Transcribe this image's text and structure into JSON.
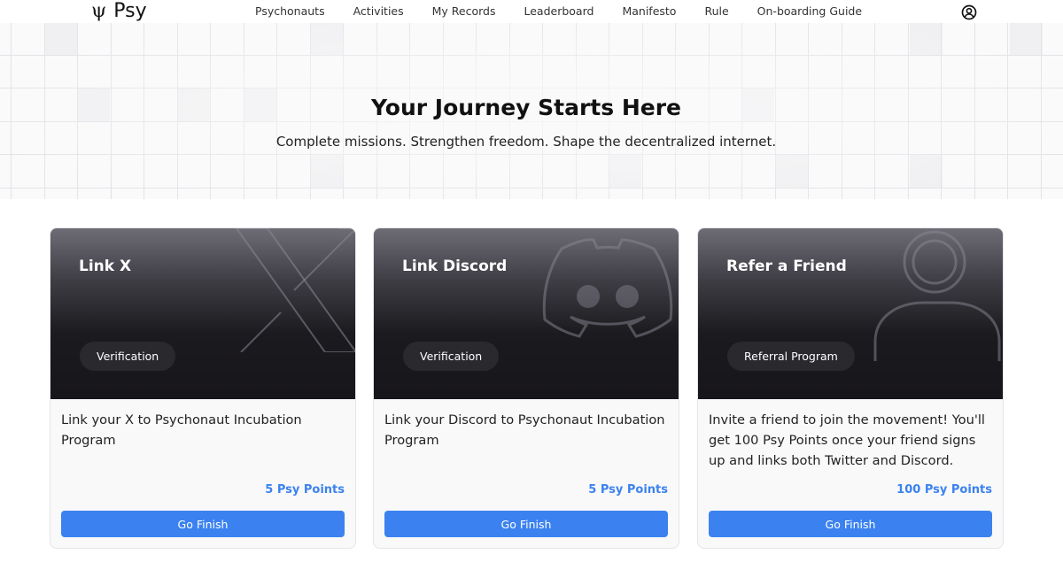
{
  "header": {
    "logo_glyph": "ψ",
    "logo_text": "Psy",
    "nav": [
      "Psychonauts",
      "Activities",
      "My Records",
      "Leaderboard",
      "Manifesto",
      "Rule",
      "On-boarding Guide"
    ],
    "profile_icon": "user-circle-icon"
  },
  "hero": {
    "title": "Your Journey Starts Here",
    "subtitle": "Complete missions. Strengthen freedom. Shape the decentralized internet."
  },
  "cards": [
    {
      "title": "Link X",
      "tag": "Verification",
      "description": "Link your X to Psychonaut Incubation Program",
      "points": "5 Psy Points",
      "button": "Go Finish",
      "icon": "x-logo-icon"
    },
    {
      "title": "Link Discord",
      "tag": "Verification",
      "description": "Link your Discord to Psychonaut Incubation Program",
      "points": "5 Psy Points",
      "button": "Go Finish",
      "icon": "discord-logo-icon"
    },
    {
      "title": "Refer a Friend",
      "tag": "Referral Program",
      "description": "Invite a friend to join the movement! You'll get 100 Psy Points once your friend signs up and links both Twitter and Discord.",
      "points": "100 Psy Points",
      "button": "Go Finish",
      "icon": "user-icon"
    }
  ],
  "colors": {
    "accent": "#3b82f0",
    "points": "#3c82ef",
    "banner_dark": "#17161a"
  }
}
